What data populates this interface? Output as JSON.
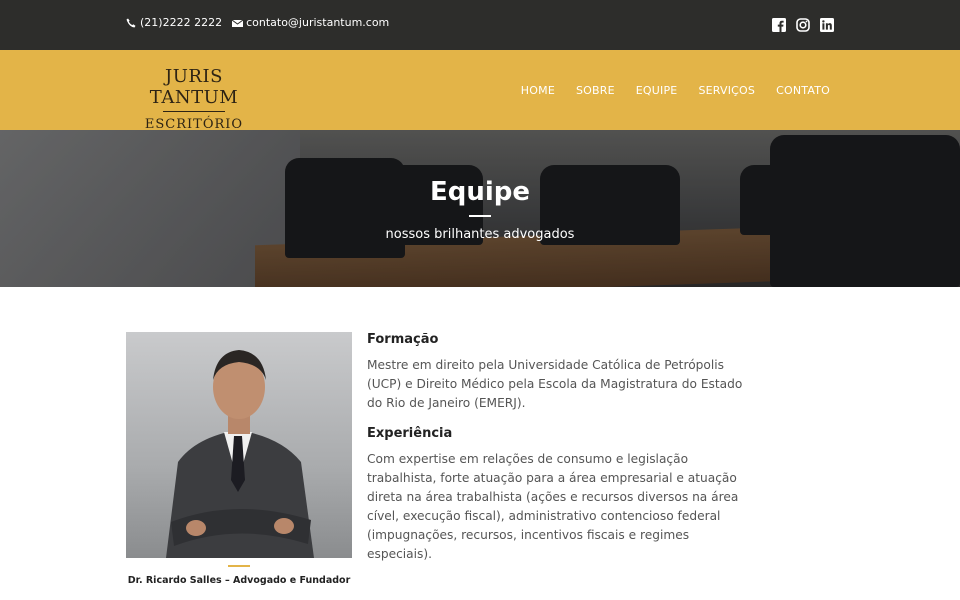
{
  "topbar": {
    "phone": "(21)2222 2222",
    "email": "contato@juristantum.com",
    "icons": [
      "phone-icon",
      "mail-icon",
      "facebook-icon",
      "instagram-icon",
      "linkedin-icon"
    ]
  },
  "header": {
    "logo_line1": "JURIS TANTUM",
    "logo_line2": "ESCRITÓRIO",
    "nav": [
      "HOME",
      "SOBRE",
      "EQUIPE",
      "SERVIÇOS",
      "CONTATO"
    ]
  },
  "hero": {
    "title": "Equipe",
    "subtitle": "nossos brilhantes advogados"
  },
  "profile": {
    "caption": "Dr. Ricardo Salles – Advogado e Fundador",
    "formacao_title": "Formação",
    "formacao_text": "Mestre em direito pela Universidade Católica de Petrópolis (UCP) e Direito Médico pela Escola da Magistratura do Estado do Rio de Janeiro (EMERJ).",
    "experiencia_title": "Experiência",
    "experiencia_text": "Com expertise em relações de consumo e legislação trabalhista, forte atuação para a área empresarial e atuação direta na área trabalhista (ações e recursos diversos na área cível, execução fiscal), administrativo contencioso federal (impugnações, recursos, incentivos fiscais e regimes especiais)."
  },
  "colors": {
    "topbar": "#2d2d2b",
    "header": "#e3b448",
    "accent": "#e3b448"
  }
}
